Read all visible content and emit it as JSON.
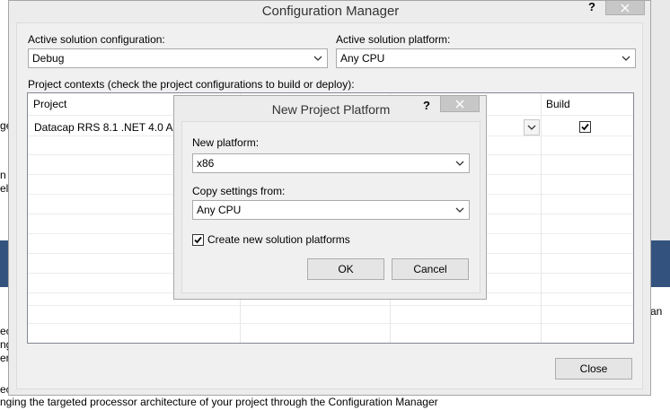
{
  "background": {
    "left_fragments": [
      "ge",
      "n",
      "el",
      "ec",
      "ng",
      "er",
      "ec"
    ],
    "right_fragment": "an",
    "bottom_text": "nging the targeted processor architecture of your project through the Configuration Manager"
  },
  "config_manager": {
    "title": "Configuration Manager",
    "help_glyph": "?",
    "active_config_label": "Active solution configuration:",
    "active_config_value": "Debug",
    "active_platform_label": "Active solution platform:",
    "active_platform_value": "Any CPU",
    "project_contexts_label": "Project contexts (check the project configurations to build or deploy):",
    "columns": [
      "Project",
      "Build"
    ],
    "rows": [
      {
        "project": "Datacap RRS 8.1 .NET 4.0 Acti",
        "build": true
      }
    ],
    "close_label": "Close"
  },
  "new_project_platform": {
    "title": "New Project Platform",
    "help_glyph": "?",
    "new_platform_label": "New platform:",
    "new_platform_value": "x86",
    "copy_settings_label": "Copy settings from:",
    "copy_settings_value": "Any CPU",
    "create_solution_platforms_label": "Create new solution platforms",
    "create_solution_platforms_checked": true,
    "ok_label": "OK",
    "cancel_label": "Cancel"
  },
  "colors": {
    "accent_blue": "#33537e",
    "window_bg": "#ececec",
    "close_button_bg": "#c7c7c7"
  }
}
